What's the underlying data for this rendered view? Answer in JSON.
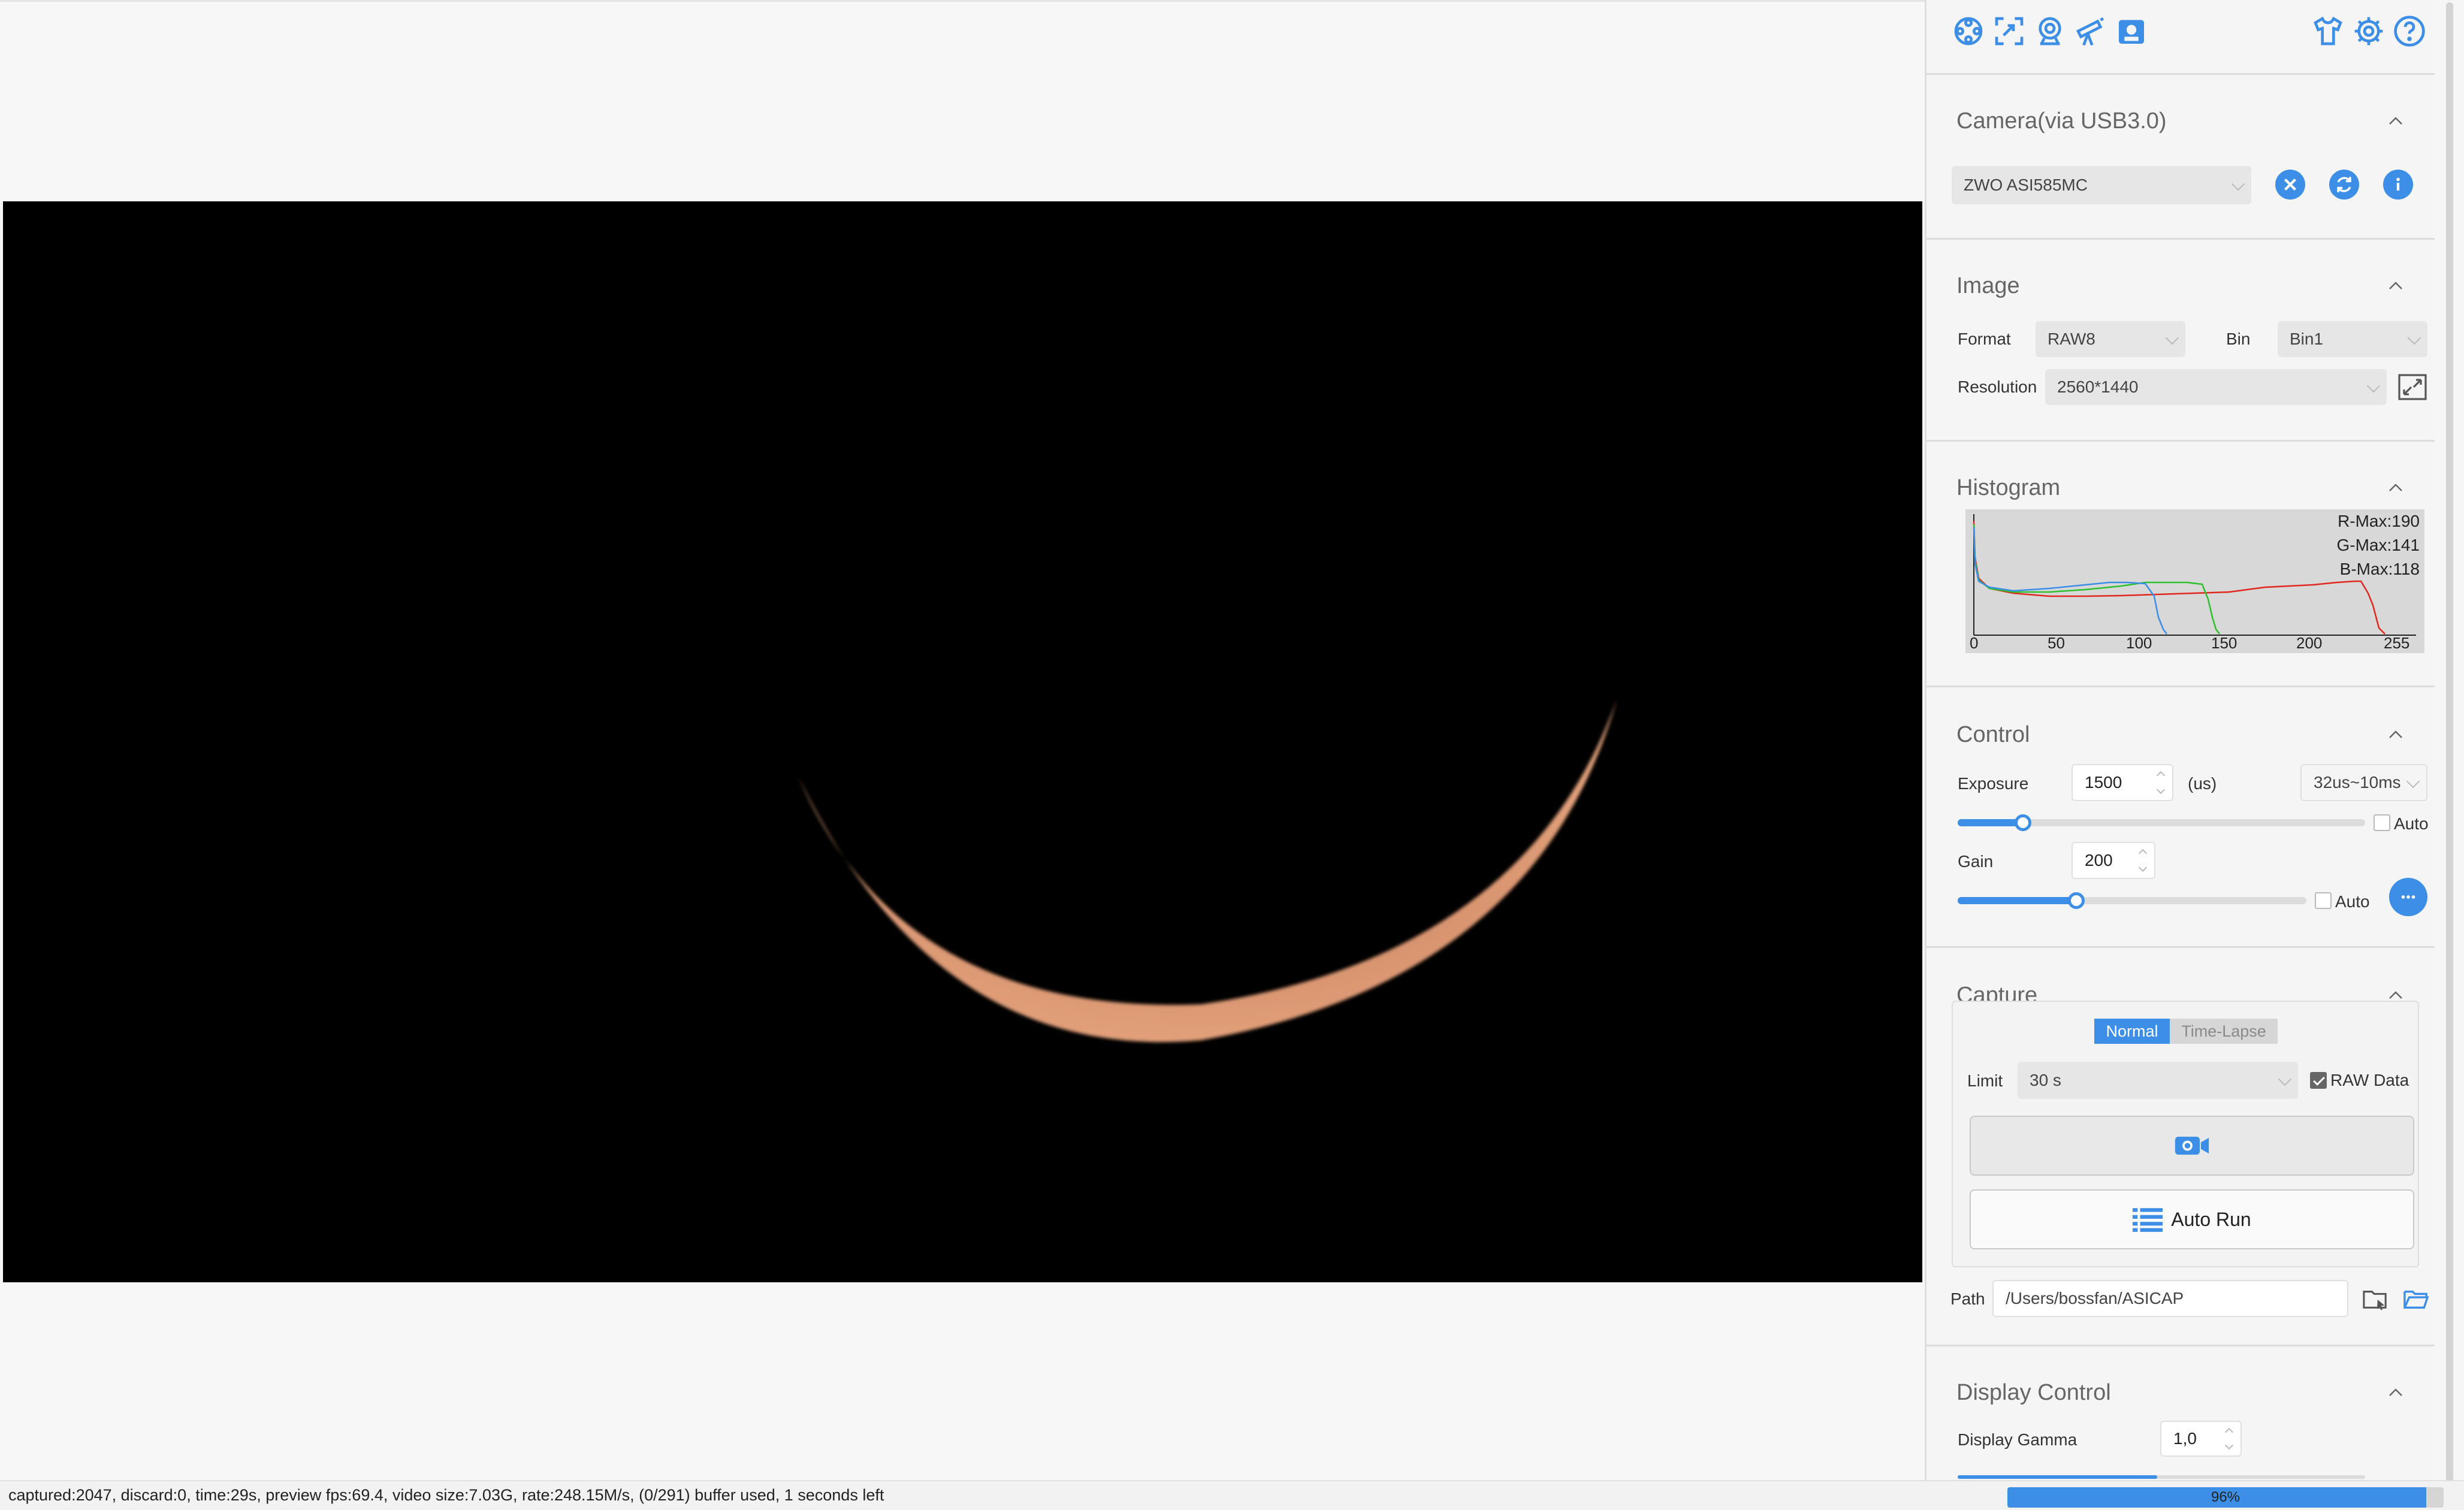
{
  "toolbar": {
    "left_icons": [
      "target-icon",
      "crop-roi-icon",
      "webcam-icon",
      "telescope-icon",
      "camera-user-icon"
    ],
    "right_icons": [
      "tshirt-theme-icon",
      "gear-icon",
      "help-icon"
    ]
  },
  "camera": {
    "title": "Camera(via USB3.0)",
    "selected": "ZWO ASI585MC"
  },
  "image": {
    "title": "Image",
    "format_label": "Format",
    "format_value": "RAW8",
    "bin_label": "Bin",
    "bin_value": "Bin1",
    "resolution_label": "Resolution",
    "resolution_value": "2560*1440"
  },
  "histogram": {
    "title": "Histogram",
    "r_max": "R-Max:190",
    "g_max": "G-Max:141",
    "b_max": "B-Max:118",
    "ticks": [
      "0",
      "50",
      "100",
      "150",
      "200",
      "255"
    ],
    "colors": {
      "red": "#e0281e",
      "green": "#2ec02e",
      "blue": "#3a8ee8"
    }
  },
  "control": {
    "title": "Control",
    "exposure_label": "Exposure",
    "exposure_value": "1500",
    "exposure_unit": "(us)",
    "exposure_range": "32us~10ms",
    "exposure_auto": "Auto",
    "exposure_slider": 0.16,
    "gain_label": "Gain",
    "gain_value": "200",
    "gain_auto": "Auto",
    "gain_slider": 0.34
  },
  "capture": {
    "title": "Capture",
    "tab_normal": "Normal",
    "tab_timelapse": "Time-Lapse",
    "limit_label": "Limit",
    "limit_value": "30 s",
    "raw_data_label": "RAW Data",
    "raw_data_checked": true,
    "auto_run_label": "Auto Run",
    "path_label": "Path",
    "path_value": "/Users/bossfan/ASICAP"
  },
  "display_control": {
    "title": "Display Control",
    "gamma_label": "Display Gamma",
    "gamma_value": "1,0"
  },
  "status": {
    "text": "captured:2047, discard:0, time:29s, preview fps:69.4, video size:7.03G, rate:248.15M/s, (0/291) buffer used, 1 seconds left",
    "progress_label": "96%",
    "progress_value": 0.96
  },
  "colors": {
    "accent": "#3d8ee6",
    "crescent": "#d9906a"
  }
}
